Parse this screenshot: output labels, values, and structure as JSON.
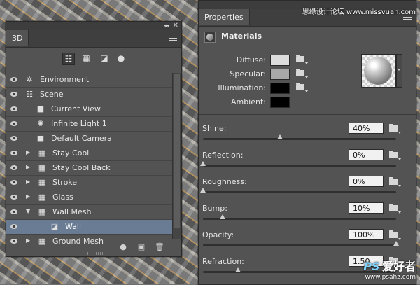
{
  "watermark_top": "思缘设计论坛 www.missvuan.com",
  "watermark_bottom": {
    "logo": "PS",
    "text": "爱好者",
    "url": "www.psahz.com"
  },
  "panel3d": {
    "tab": "3D",
    "rows": [
      {
        "label": "Environment",
        "icon": "environment-icon",
        "arrow": ""
      },
      {
        "label": "Scene",
        "icon": "scene-icon",
        "arrow": ""
      },
      {
        "label": "Current View",
        "icon": "camera-icon",
        "arrow": ""
      },
      {
        "label": "Infinite Light 1",
        "icon": "light-icon",
        "arrow": ""
      },
      {
        "label": "Default Camera",
        "icon": "camera-icon",
        "arrow": ""
      },
      {
        "label": "Stay  Cool",
        "icon": "mesh-icon",
        "arrow": "▶"
      },
      {
        "label": "Stay  Cool Back",
        "icon": "mesh-icon",
        "arrow": "▶"
      },
      {
        "label": "Stroke",
        "icon": "mesh-icon",
        "arrow": "▶"
      },
      {
        "label": "Glass",
        "icon": "mesh-icon",
        "arrow": "▶"
      },
      {
        "label": "Wall Mesh",
        "icon": "mesh-icon",
        "arrow": "▼"
      },
      {
        "label": "Wall",
        "icon": "material-icon",
        "arrow": ""
      },
      {
        "label": "Ground Mesh",
        "icon": "mesh-icon",
        "arrow": "▶"
      }
    ]
  },
  "properties": {
    "tab": "Properties",
    "section": "Materials",
    "swatches": [
      {
        "label": "Diffuse:",
        "color": "#dcdcdc"
      },
      {
        "label": "Specular:",
        "color": "#a8a8a8"
      },
      {
        "label": "Illumination:",
        "color": "#000000"
      },
      {
        "label": "Ambient:",
        "color": "#000000"
      }
    ],
    "sliders": [
      {
        "name": "Shine:",
        "value": "40%",
        "level": 0.4
      },
      {
        "name": "Reflection:",
        "value": "0%",
        "level": 0
      },
      {
        "name": "Roughness:",
        "value": "0%",
        "level": 0
      },
      {
        "name": "Bump:",
        "value": "10%",
        "level": 0.1
      },
      {
        "name": "Opacity:",
        "value": "100%",
        "level": 1
      },
      {
        "name": "Refraction:",
        "value": "1.50",
        "level": 0.18
      }
    ]
  }
}
